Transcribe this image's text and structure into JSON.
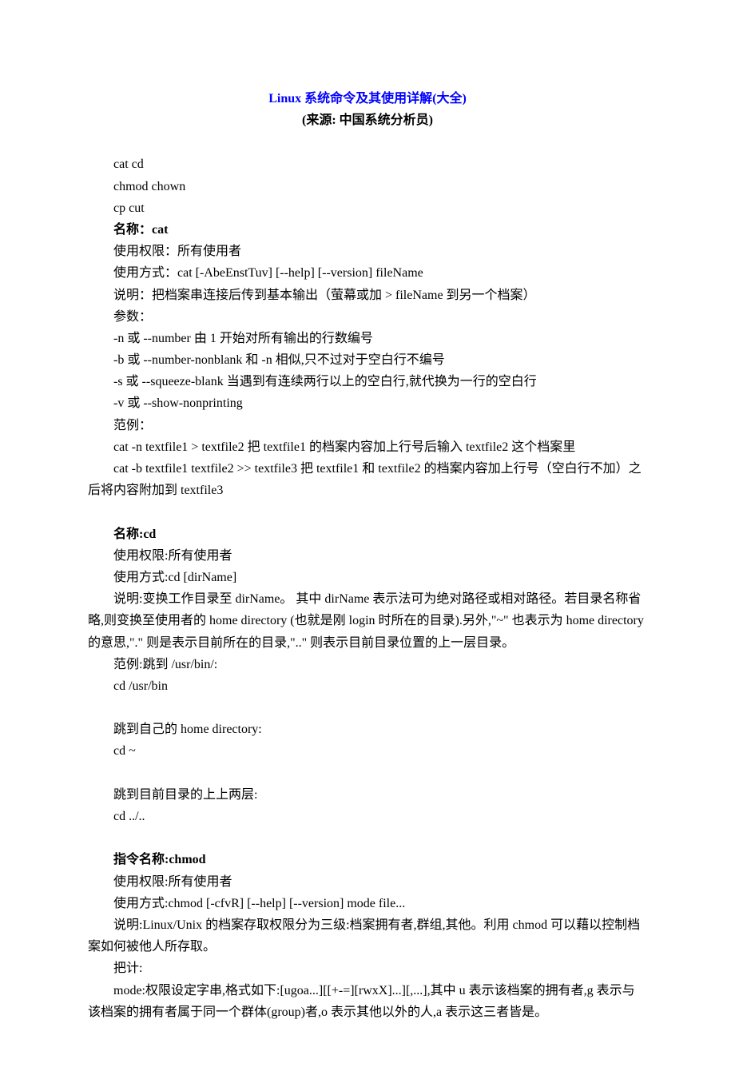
{
  "title": "Linux 系统命令及其使用详解(大全)",
  "subtitle": "(来源: 中国系统分析员)",
  "intro": {
    "l1": "cat cd",
    "l2": "chmod chown",
    "l3": "cp cut"
  },
  "cat": {
    "name_label": "名称：cat",
    "perm": "使用权限：所有使用者",
    "usage": "使用方式：cat [-AbeEnstTuv] [--help] [--version] fileName",
    "desc": "说明：把档案串连接后传到基本输出（萤幕或加 > fileName 到另一个档案）",
    "params_label": "参数：",
    "p1": "-n 或 --number 由 1 开始对所有输出的行数编号",
    "p2": "-b 或 --number-nonblank 和 -n 相似,只不过对于空白行不编号",
    "p3": "-s 或 --squeeze-blank 当遇到有连续两行以上的空白行,就代换为一行的空白行",
    "p4": "-v 或 --show-nonprinting",
    "ex_label": "范例：",
    "ex1": "cat -n textfile1 > textfile2 把 textfile1 的档案内容加上行号后输入 textfile2 这个档案里",
    "ex2": "cat -b textfile1 textfile2 >> textfile3 把 textfile1 和 textfile2 的档案内容加上行号（空白行不加）之后将内容附加到 textfile3"
  },
  "cd": {
    "name_label": "名称:cd",
    "perm": "使用权限:所有使用者",
    "usage": "使用方式:cd [dirName]",
    "desc": "说明:变换工作目录至 dirName。 其中 dirName 表示法可为绝对路径或相对路径。若目录名称省略,则变换至使用者的 home directory (也就是刚 login 时所在的目录).另外,\"~\" 也表示为 home directory 的意思,\".\" 则是表示目前所在的目录,\"..\" 则表示目前目录位置的上一层目录。",
    "ex_label": "范例:跳到 /usr/bin/:",
    "ex1": "cd /usr/bin",
    "ex2_label": "跳到自己的 home directory:",
    "ex2": "cd ~",
    "ex3_label": "跳到目前目录的上上两层:",
    "ex3": "cd ../.."
  },
  "chmod": {
    "name_label": "指令名称:chmod",
    "perm": "使用权限:所有使用者",
    "usage": "使用方式:chmod [-cfvR] [--help] [--version] mode file...",
    "desc": "说明:Linux/Unix 的档案存取权限分为三级:档案拥有者,群组,其他。利用 chmod 可以藉以控制档案如何被他人所存取。",
    "calc_label": "把计:",
    "mode": "mode:权限设定字串,格式如下:[ugoa...][[+-=][rwxX]...][,...],其中 u 表示该档案的拥有者,g 表示与该档案的拥有者属于同一个群体(group)者,o 表示其他以外的人,a 表示这三者皆是。"
  }
}
